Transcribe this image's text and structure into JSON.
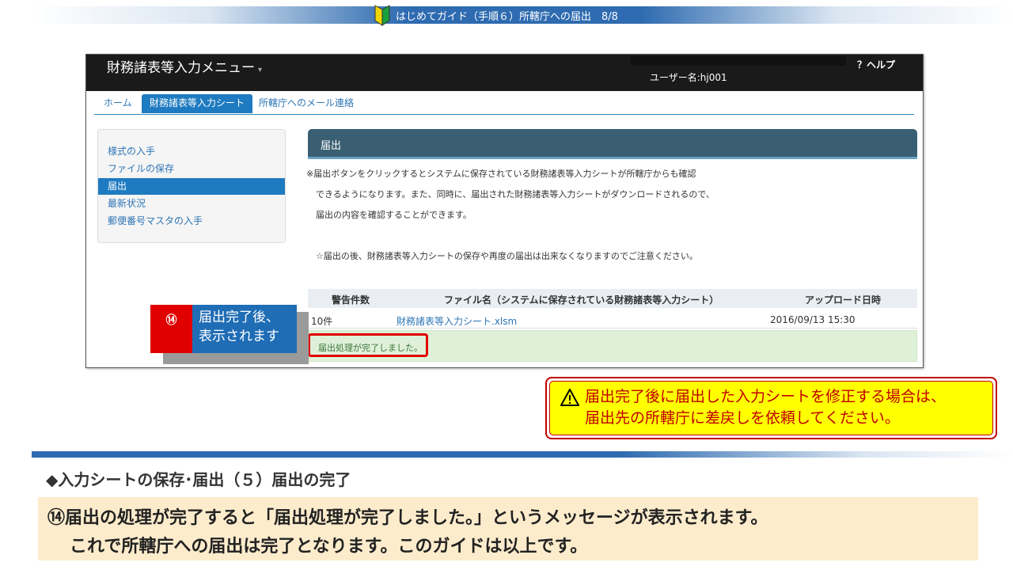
{
  "banner": {
    "title": "はじめてガイド（手順６）所轄庁への届出　8/8",
    "icon": "beginner-leaf-icon"
  },
  "app": {
    "title": "財務諸表等入力メニュー",
    "caret": "▾",
    "user_label": "ユーザー名:hj001",
    "help": "？ヘルプ",
    "tabs": {
      "home": "ホーム",
      "sheet": "財務諸表等入力シート",
      "mail": "所轄庁へのメール連絡"
    },
    "side_menu": [
      {
        "label": "様式の入手"
      },
      {
        "label": "ファイルの保存"
      },
      {
        "label": "届出"
      },
      {
        "label": "最新状況"
      },
      {
        "label": "郵便番号マスタの入手"
      }
    ],
    "panel_title": "届出",
    "notice_lines": [
      "※届出ボタンをクリックするとシステムに保存されている財務諸表等入力シートが所轄庁からも確認",
      "できるようになります。また、同時に、届出された財務諸表等入力シートがダウンロードされるので、",
      "届出の内容を確認することができます。",
      "☆届出の後、財務諸表等入力シートの保存や再度の届出は出来なくなりますのでご注意ください。"
    ],
    "table": {
      "headers": [
        "警告件数",
        "ファイル名（システムに保存されている財務諸表等入力シート）",
        "アップロード日時"
      ],
      "row": {
        "warnings": "10件",
        "file": "財務諸表等入力シート.xlsm",
        "uploaded": "2016/09/13 15:30"
      }
    },
    "success_message": "届出処理が完了しました。"
  },
  "callout": {
    "number": "⑭",
    "line1": "届出完了後、",
    "line2": "表示されます"
  },
  "warning": {
    "line1": "届出完了後に届出した入力シートを修正する場合は、",
    "line2": "届出先の所轄庁に差戻しを依頼してください。"
  },
  "section": {
    "heading": "◆入力シートの保存･届出（５）届出の完了",
    "explain_line1": "⑭届出の処理が完了すると「届出処理が完了しました。」というメッセージが表示されます。",
    "explain_line2": "これで所轄庁への届出は完了となります。このガイドは以上です。"
  },
  "colors": {
    "accent_blue": "#1f7bc1",
    "alert_red": "#e00000",
    "warning_yellow": "#ffff00",
    "success_green": "#dff0d8",
    "explain_bg": "#fdeccc"
  }
}
